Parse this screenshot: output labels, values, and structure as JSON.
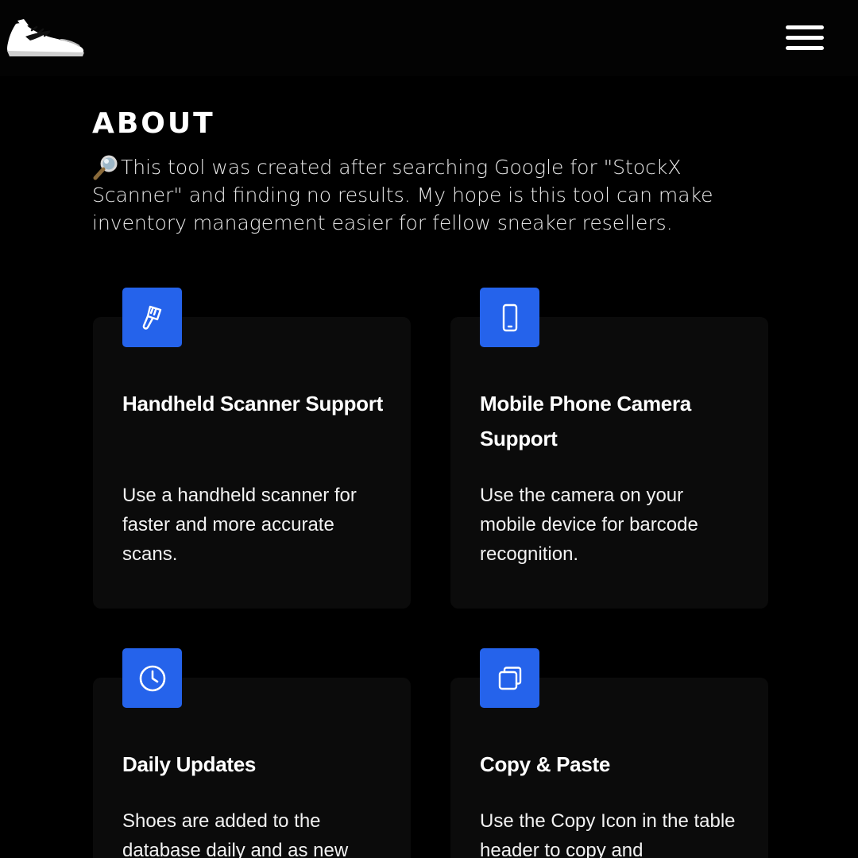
{
  "header": {
    "logo_icon": "sneaker-logo-icon",
    "menu_icon": "hamburger-menu-icon"
  },
  "about": {
    "title": "ABOUT",
    "intro_icon": "magnifying-glass-icon",
    "intro_text": "This tool was created after searching Google for \"StockX Scanner\" and finding no results. My hope is this tool can make inventory management easier for fellow sneaker resellers."
  },
  "features": [
    {
      "icon": "barcode-scanner-icon",
      "title": "Handheld Scanner Support",
      "description": "Use a handheld scanner for faster and more accurate scans."
    },
    {
      "icon": "mobile-phone-icon",
      "title": "Mobile Phone Camera Support",
      "description": "Use the camera on your mobile device for barcode recognition."
    },
    {
      "icon": "clock-icon",
      "title": "Daily Updates",
      "description": "Shoes are added to the database daily and as new"
    },
    {
      "icon": "copy-icon",
      "title": "Copy & Paste",
      "description": "Use the Copy Icon in the table header to copy and"
    }
  ],
  "colors": {
    "background": "#000000",
    "card_background": "#0b0b0b",
    "accent": "#2563eb",
    "text": "#ffffff"
  }
}
